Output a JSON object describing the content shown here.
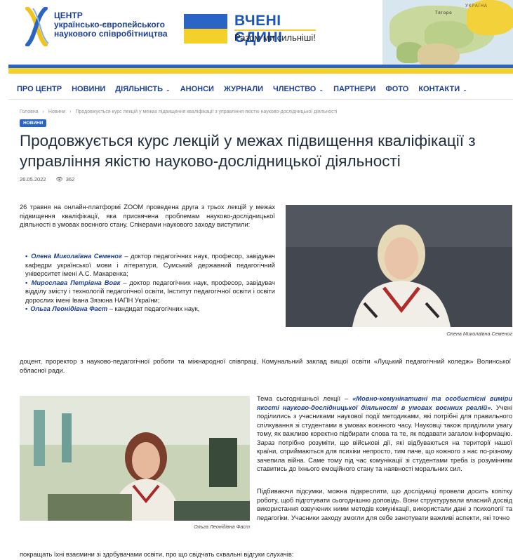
{
  "logo": {
    "line1": "ЦЕНТР",
    "line2": "українсько-європейського",
    "line3": "наукового співробітництва"
  },
  "banner": {
    "title": "ВЧЕНІ ЄДИНІ",
    "subtitle": "Разом ми сильніші!"
  },
  "map": {
    "labels": [
      "УКРАЇНА",
      "Тягоро"
    ]
  },
  "nav": {
    "items": [
      {
        "label": "ПРО ЦЕНТР",
        "dropdown": false
      },
      {
        "label": "НОВИНИ",
        "dropdown": false
      },
      {
        "label": "ДІЯЛЬНІСТЬ",
        "dropdown": true
      },
      {
        "label": "АНОНСИ",
        "dropdown": false
      },
      {
        "label": "ЖУРНАЛИ",
        "dropdown": false
      },
      {
        "label": "ЧЛЕНСТВО",
        "dropdown": true
      },
      {
        "label": "ПАРТНЕРИ",
        "dropdown": false
      },
      {
        "label": "ФОТО",
        "dropdown": false
      },
      {
        "label": "КОНТАКТИ",
        "dropdown": true
      }
    ]
  },
  "breadcrumb": {
    "home": "Головна",
    "section": "Новини",
    "current": "Продовжується курс лекцій у межах підвищення кваліфікації з управління якістю науково-дослідницької діяльності",
    "separator": "›"
  },
  "article": {
    "badge": "НОВИНИ",
    "title": "Продовжується курс лекцій у межах підвищення кваліфікації з управління якістю науково-дослідницької діяльності",
    "date": "26.05.2022",
    "views": "362",
    "intro": "26 травня на онлайн-платформі ZOOM проведена друга з трьох лекцій у межах підвищення кваліфікації, яка присвячена проблемам науково-дослідницької діяльності в умовах воєнного стану. Спікерами наукового заходу виступили:",
    "speakers": [
      {
        "name": "Олена Миколаївна Семеног",
        "desc": " – доктор педагогічних наук, професор, завідувач кафедри української мови і літератури, Сумський державний педагогічний університет імені А.С. Макаренка;"
      },
      {
        "name": "Мирослава Петрівна Вовк",
        "desc": " – доктор педагогічних наук, професор, завідувач відділу змісту і технологій педагогічної освіти, Інститут педагогічної освіти і освіти дорослих імені Івана Зязюна НАПН України;"
      },
      {
        "name": "Ольга Леонідівна Фаст",
        "desc": " – кандидат педагогічних наук,"
      }
    ],
    "speaker3_tail": "доцент, проректор з науково-педагогічної роботи та міжнародної співпраці, Комунальний заклад вищої освіти «Луцький педагогічний коледж» Волинської обласної ради.",
    "photo1_caption": "Олена Миколаївна Семеног",
    "photo2_caption": "Ольга Леонідівна Фаст",
    "topic_prefix": "Тема сьогоднішньої лекції – ",
    "topic_quote": "«Мовно-комунікативні та особистісні виміри якості науково-дослідницької діяльності в умовах воєнних реалій»",
    "topic_rest": ". Учені поділились з учасниками наукової події методиками, які потрібні для правильного спілкування зі студентами в умовах воєнного часу. Науковці також приділили увагу тому, як важливо коректно підбирати слова та те, як подавати загалом інформацію. Зараз потрібно розуміти, що військові дії, які відбуваються на території нашої країни, сприймаються для психіки непросто, тим паче, що кожного з нас по-різному зачепила війна. Саме тому під час комунікації зі студентами треба із розумінням ставитись до їхнього емоційного стану та наявності моральних сил.",
    "summary": "Підбиваючи підсумки, можна підкреслити, що дослідниці провели досить копітку роботу, щоб підготувати сьогоднішню доповідь. Вони структурували власний досвід використання озвучених ними методів комунікації, використали дані з психології та педагогіки. Учасники заходу змогли для себе занотувати важливі аспекти, які точно",
    "summary_tail": "покращать їхні взаємини зі здобувачами освіти, про що свідчать схвальні відгуки слухачів:"
  }
}
